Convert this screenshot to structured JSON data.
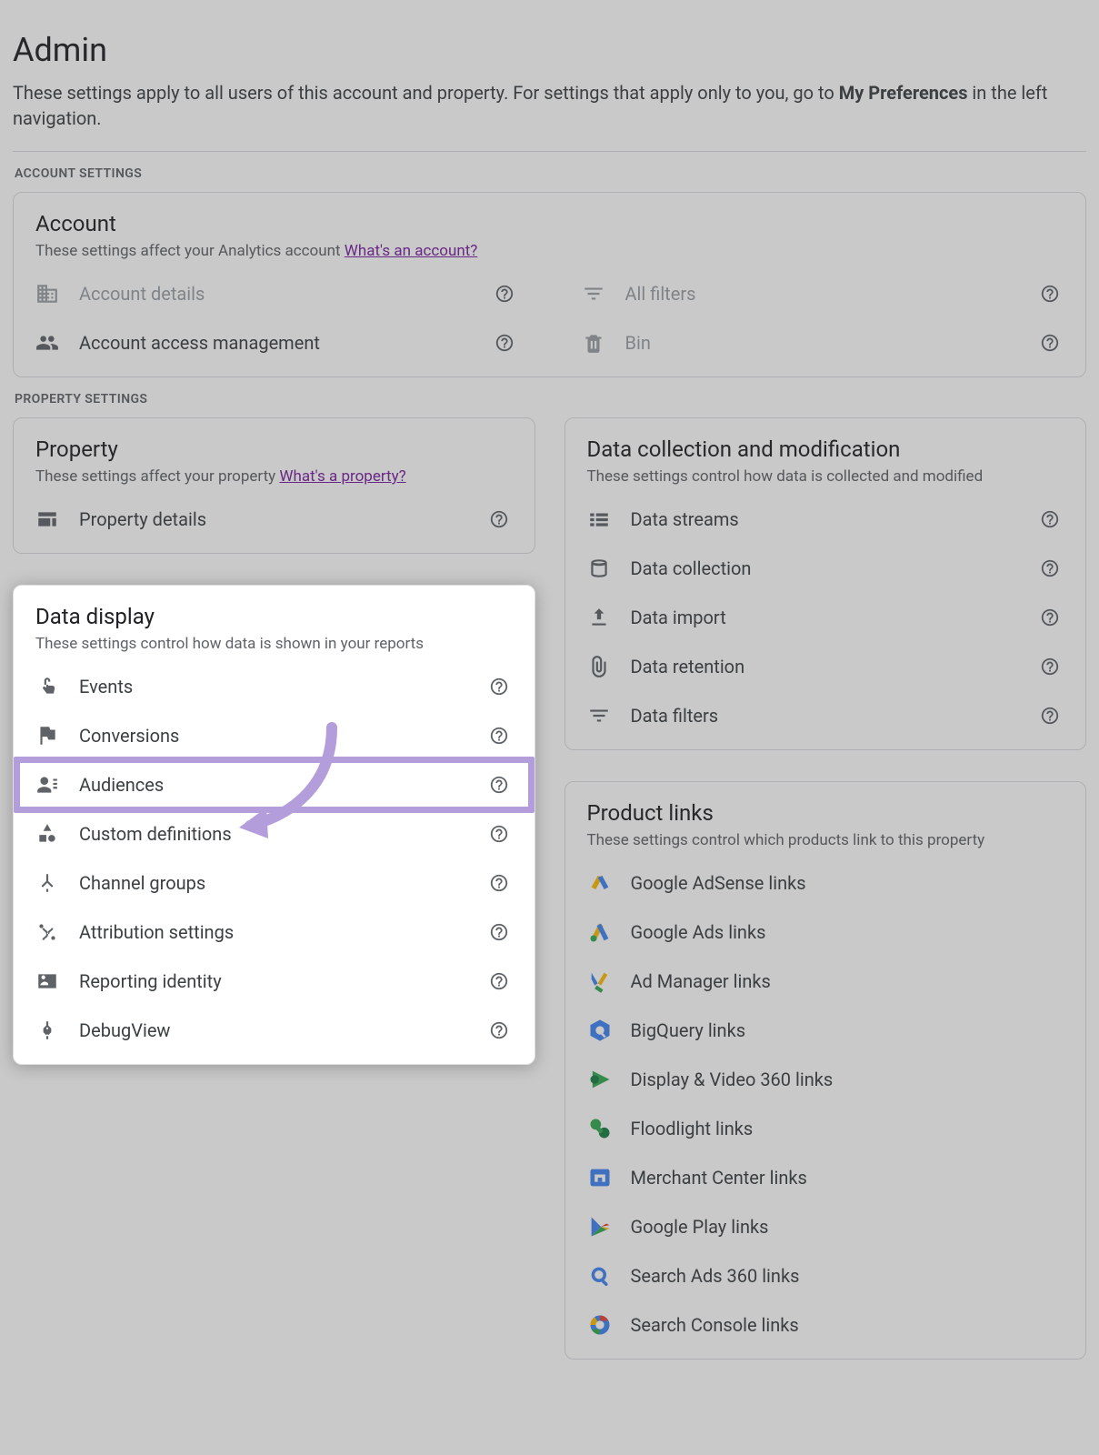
{
  "header": {
    "title": "Admin",
    "desc_pre": "These settings apply to all users of this account and property. For settings that apply only to you, go to ",
    "desc_bold": "My Preferences",
    "desc_post": " in the left navigation."
  },
  "sections": {
    "account_label": "ACCOUNT SETTINGS",
    "property_label": "PROPERTY SETTINGS"
  },
  "account": {
    "title": "Account",
    "sub": "These settings affect your Analytics account ",
    "link": "What's an account?",
    "items": [
      {
        "name": "account-details",
        "label": "Account details",
        "icon": "domain",
        "muted": true
      },
      {
        "name": "all-filters",
        "label": "All filters",
        "icon": "filter",
        "muted": true
      },
      {
        "name": "account-access",
        "label": "Account access management",
        "icon": "people",
        "muted": false
      },
      {
        "name": "bin",
        "label": "Bin",
        "icon": "trash",
        "muted": true
      }
    ]
  },
  "property": {
    "title": "Property",
    "sub": "These settings affect your property ",
    "link": "What's a property?",
    "items": [
      {
        "name": "property-details",
        "label": "Property details",
        "icon": "web"
      }
    ]
  },
  "data_display": {
    "title": "Data display",
    "sub": "These settings control how data is shown in your reports",
    "items": [
      {
        "name": "events",
        "label": "Events",
        "icon": "touch"
      },
      {
        "name": "conversions",
        "label": "Conversions",
        "icon": "flag"
      },
      {
        "name": "audiences",
        "label": "Audiences",
        "icon": "personlist",
        "highlight": true
      },
      {
        "name": "custom-definitions",
        "label": "Custom definitions",
        "icon": "shapes"
      },
      {
        "name": "channel-groups",
        "label": "Channel groups",
        "icon": "merge"
      },
      {
        "name": "attribution",
        "label": "Attribution settings",
        "icon": "route"
      },
      {
        "name": "reporting-identity",
        "label": "Reporting identity",
        "icon": "idcard"
      },
      {
        "name": "debugview",
        "label": "DebugView",
        "icon": "debug"
      }
    ]
  },
  "data_collection": {
    "title": "Data collection and modification",
    "sub": "These settings control how data is collected and modified",
    "items": [
      {
        "name": "data-streams",
        "label": "Data streams",
        "icon": "streams"
      },
      {
        "name": "data-collection",
        "label": "Data collection",
        "icon": "db"
      },
      {
        "name": "data-import",
        "label": "Data import",
        "icon": "upload"
      },
      {
        "name": "data-retention",
        "label": "Data retention",
        "icon": "clip"
      },
      {
        "name": "data-filters",
        "label": "Data filters",
        "icon": "filter"
      }
    ]
  },
  "product_links": {
    "title": "Product links",
    "sub": "These settings control which products link to this property",
    "items": [
      {
        "name": "adsense",
        "label": "Google AdSense links",
        "icon": "adsense"
      },
      {
        "name": "ads",
        "label": "Google Ads links",
        "icon": "ads"
      },
      {
        "name": "admanager",
        "label": "Ad Manager links",
        "icon": "admanager"
      },
      {
        "name": "bigquery",
        "label": "BigQuery links",
        "icon": "bigquery"
      },
      {
        "name": "dv360",
        "label": "Display & Video 360 links",
        "icon": "dv360"
      },
      {
        "name": "floodlight",
        "label": "Floodlight links",
        "icon": "floodlight"
      },
      {
        "name": "merchant",
        "label": "Merchant Center links",
        "icon": "merchant"
      },
      {
        "name": "play",
        "label": "Google Play links",
        "icon": "play"
      },
      {
        "name": "sa360",
        "label": "Search Ads 360 links",
        "icon": "sa360"
      },
      {
        "name": "searchconsole",
        "label": "Search Console links",
        "icon": "searchconsole"
      }
    ]
  }
}
